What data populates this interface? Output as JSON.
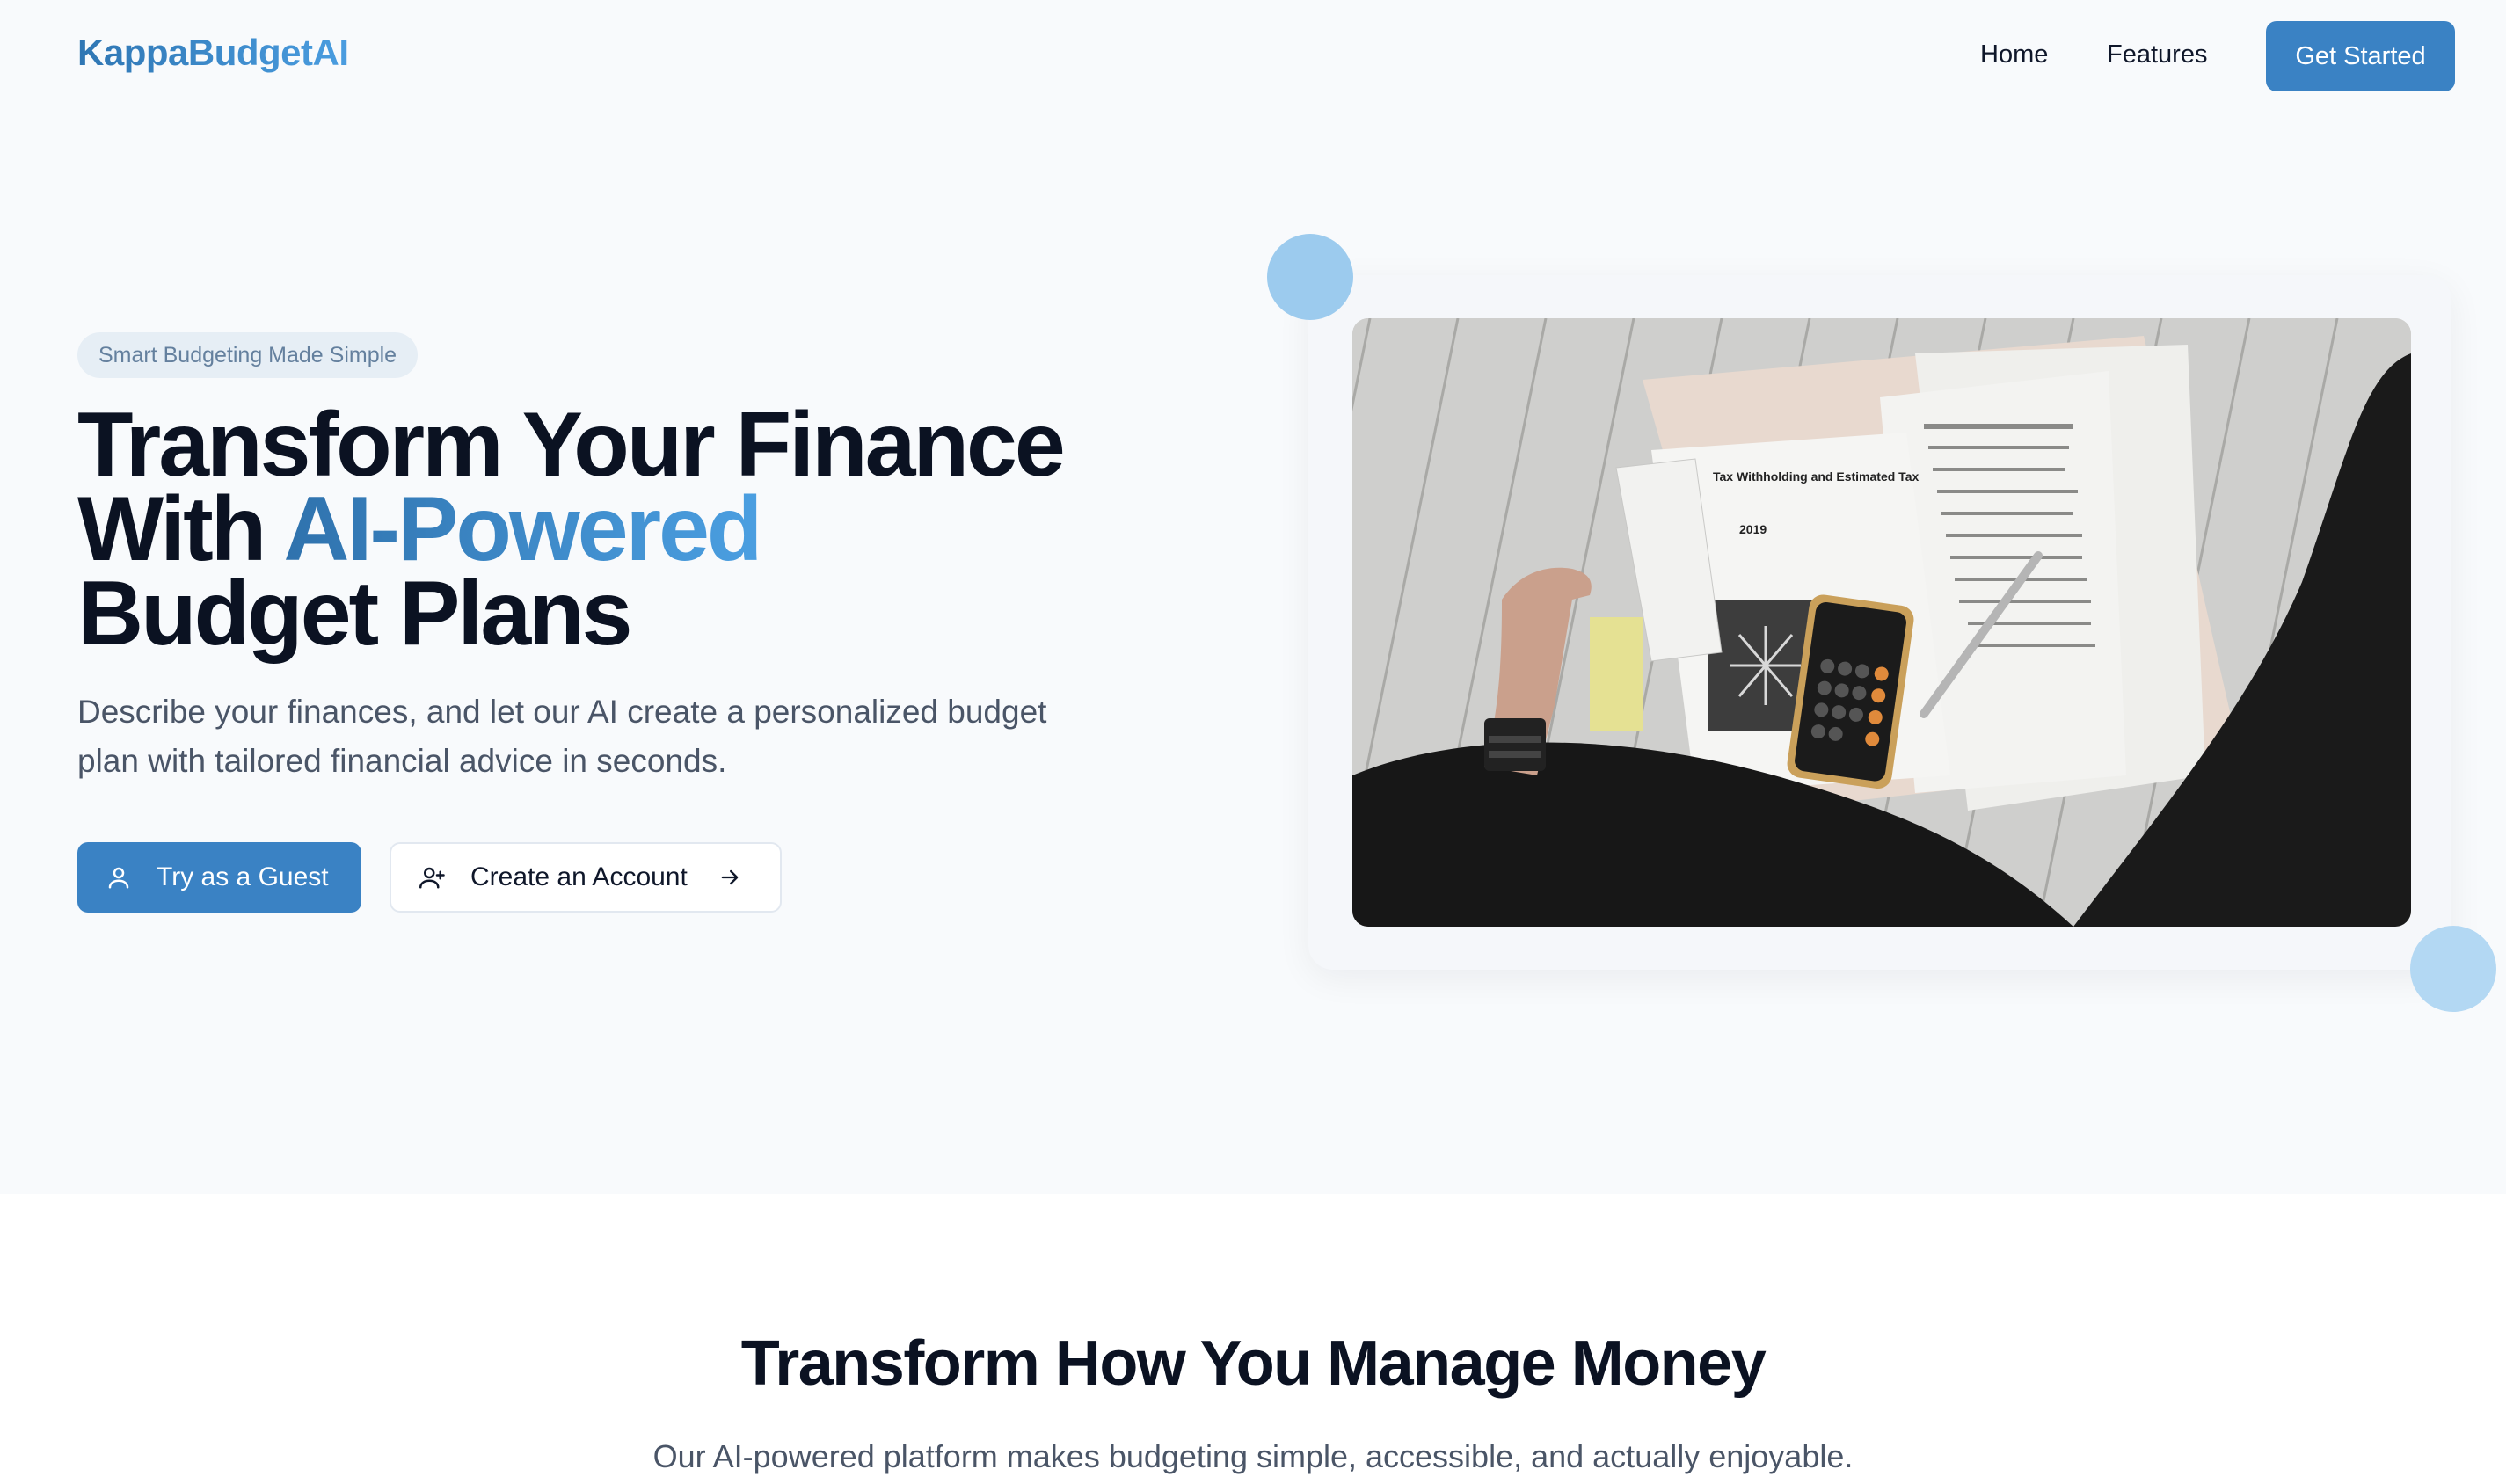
{
  "nav": {
    "logo": "KappaBudgetAI",
    "links": [
      "Home",
      "Features"
    ],
    "cta": "Get Started"
  },
  "hero": {
    "badge": "Smart Budgeting Made Simple",
    "headline_line1": "Transform Your Finance",
    "headline_line2_prefix": "With ",
    "headline_accent": "AI-Powered",
    "headline_line3": "Budget Plans",
    "subtitle": "Describe your finances, and let our AI create a personalized budget plan with tailored financial advice in seconds.",
    "primary_button": "Try as a Guest",
    "secondary_button": "Create an Account",
    "image_document_title": "Tax Withholding and Estimated Tax",
    "image_document_year": "2019"
  },
  "features": {
    "title": "Transform How You Manage Money",
    "subtitle": "Our AI-powered platform makes budgeting simple, accessible, and actually enjoyable."
  },
  "colors": {
    "primary": "#3a82c4",
    "accent_gradient_start": "#2f72ad",
    "accent_gradient_end": "#4b9fe1",
    "hero_background": "#f8fafc",
    "circle": "#9ccbee"
  },
  "icons": {
    "guest": "user-icon",
    "account": "user-plus-icon",
    "arrow": "arrow-right-icon"
  }
}
